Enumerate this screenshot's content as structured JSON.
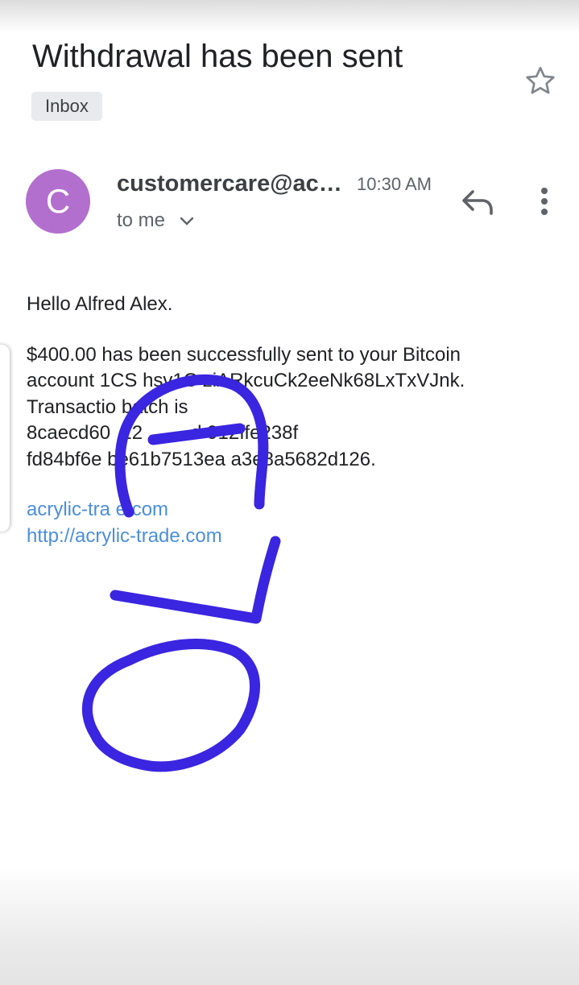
{
  "email": {
    "subject": "Withdrawal has been sent",
    "label": "Inbox",
    "sender_initial": "C",
    "sender": "customercare@acrylic-trade.com",
    "time": "10:30 AM",
    "recipient": "to me"
  },
  "body": {
    "greeting": "Hello Alfred Alex.",
    "lines": [
      "$400.00 has been successfully sent to your Bitcoin",
      "account 1CS hsv1C ziARkcuCk2eeNk68LxTxVJnk.",
      "Transactio batch is",
      "8caecd60  12         d 912ffe238f",
      "fd84bf6e be61b7513ea a3e8a5682d126."
    ],
    "links": [
      "acrylic-tra e.com",
      "http://acrylic-trade.com"
    ]
  },
  "annotation": {
    "text": "OLD",
    "color": "#3a25e0"
  },
  "icons": {
    "star": "star-icon",
    "reply": "reply-icon",
    "more": "more-vert-icon",
    "expand": "chevron-down-icon"
  }
}
